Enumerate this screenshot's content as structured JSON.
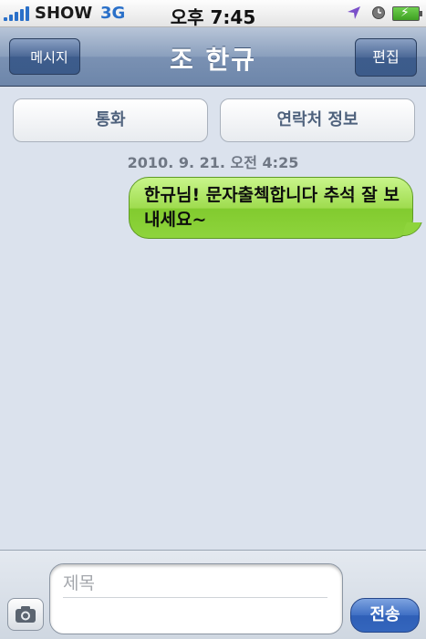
{
  "status_bar": {
    "carrier": "SHOW",
    "network": "3G",
    "time": "오후 7:45",
    "icons": [
      "signal-icon",
      "location-icon",
      "lock-rotation-icon",
      "battery-charging-icon"
    ]
  },
  "nav": {
    "back_label": "메시지",
    "title": "조 한규",
    "edit_label": "편집"
  },
  "actions": {
    "call_label": "통화",
    "contact_label": "연락처 정보"
  },
  "conversation": {
    "timestamp": "2010. 9. 21. 오전 4:25",
    "messages": [
      {
        "direction": "outgoing",
        "text": "한규님! 문자출첵합니다 추석 잘 보내세요~"
      }
    ]
  },
  "composer": {
    "subject_placeholder": "제목",
    "send_label": "전송",
    "camera_icon": "camera-icon"
  },
  "colors": {
    "background": "#dbe2ed",
    "bubble_green": "#8ed43c",
    "nav_blue": "#6d86aa",
    "send_blue": "#3466bd"
  }
}
